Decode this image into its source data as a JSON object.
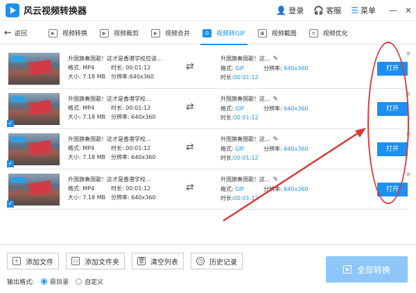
{
  "app": {
    "title": "风云视频转换器",
    "accent": "#1b8ff2"
  },
  "titlebar": {
    "login": "登录",
    "service": "客服",
    "menu": "菜单",
    "minimize": "—",
    "close": "✕"
  },
  "nav": {
    "back": "返回",
    "tabs": [
      {
        "label": "视频转换",
        "icon": "play-icon"
      },
      {
        "label": "视频裁剪",
        "icon": "crop-icon"
      },
      {
        "label": "视频合并",
        "icon": "merge-icon"
      },
      {
        "label": "视频转GIF",
        "icon": "gif-icon"
      },
      {
        "label": "视频截图",
        "icon": "screenshot-icon"
      },
      {
        "label": "视频优化",
        "icon": "optimize-icon"
      }
    ]
  },
  "files": [
    {
      "src_name": "升国旗奏国歌！这才是香港学校应该...",
      "format_label": "格式:",
      "format": "MP4",
      "duration_label": "时长:",
      "duration": "00:01:12",
      "size_label": "大小:",
      "size": "7.18 MB",
      "res_label": "分辨率:",
      "resolution": "640x360",
      "dst_name": "升国旗奏国歌！这...",
      "dst_format": "GIF",
      "dst_resolution": "640x360",
      "dst_duration": "00:01:12",
      "open": "打开"
    },
    {
      "src_name": "升国旗奏国歌！这才是香港学校...",
      "format_label": "格式:",
      "format": "MP4",
      "duration_label": "时长:",
      "duration": "00:01:12",
      "size_label": "大小:",
      "size": "7.18 MB",
      "res_label": "分辨率:",
      "resolution": "640x360",
      "dst_name": "升国旗奏国歌！这...",
      "dst_format": "GIF",
      "dst_resolution": "640x360",
      "dst_duration": "00:01:12",
      "open": "打开"
    },
    {
      "src_name": "升国旗奏国歌！这才是香港学校...",
      "format_label": "格式:",
      "format": "MP4",
      "duration_label": "时长:",
      "duration": "00:01:12",
      "size_label": "大小:",
      "size": "7.18 MB",
      "res_label": "分辨率:",
      "resolution": "640x360",
      "dst_name": "升国旗奏国歌！这...",
      "dst_format": "GIF",
      "dst_resolution": "640x360",
      "dst_duration": "00:01:12",
      "open": "打开"
    },
    {
      "src_name": "升国旗奏国歌！这才是香港学校...",
      "format_label": "格式:",
      "format": "MP4",
      "duration_label": "时长:",
      "duration": "00:01:12",
      "size_label": "大小:",
      "size": "7.18 MB",
      "res_label": "分辨率:",
      "resolution": "640x360",
      "dst_name": "升国旗奏国歌！这...",
      "dst_format": "GIF",
      "dst_resolution": "640x360",
      "dst_duration": "00:01:12",
      "open": "打开"
    }
  ],
  "dst_labels": {
    "format": "格式:",
    "resolution": "分辨率:",
    "duration": "时长:"
  },
  "bottom": {
    "add_file": "添加文件",
    "add_folder": "添加文件夹",
    "clear_list": "清空列表",
    "history": "历史记录",
    "output_format_label": "输出格式:",
    "option_original": "原目录",
    "option_custom": "自定义",
    "convert_all": "全部转换"
  },
  "annotation_color": "#d63a3a"
}
